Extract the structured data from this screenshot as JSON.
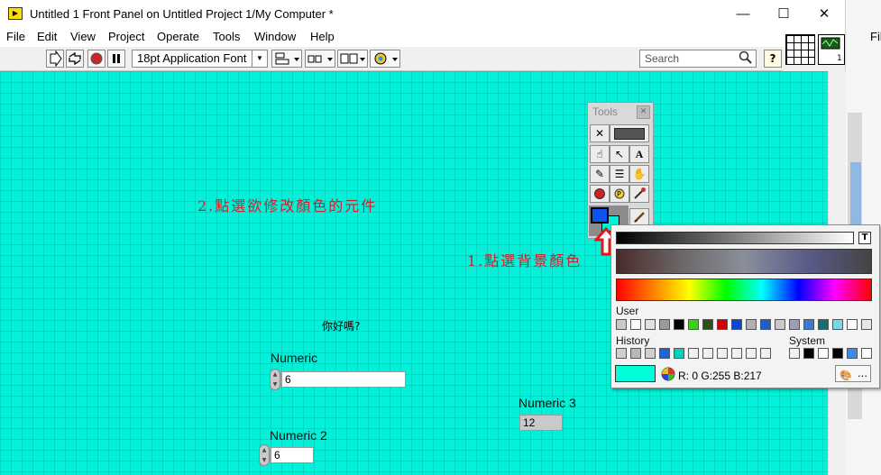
{
  "window": {
    "title": "Untitled 1 Front Panel on Untitled Project 1/My Computer *",
    "controls": {
      "minimize": "—",
      "maximize": "☐",
      "close": "✕"
    }
  },
  "menu": [
    "File",
    "Edit",
    "View",
    "Project",
    "Operate",
    "Tools",
    "Window",
    "Help"
  ],
  "toolbar": {
    "font": "18pt Application Font",
    "search_placeholder": "Search",
    "help": "?"
  },
  "panel": {
    "background": "#03f0d9",
    "annotation_1": "1.點選背景顏色",
    "annotation_2": "2.點選欲修改顏色的元件",
    "free_label": "你好嗎?",
    "controls": [
      {
        "label": "Numeric",
        "value": "6"
      },
      {
        "label": "Numeric 2",
        "value": "6"
      },
      {
        "label": "Numeric 3",
        "value": "12"
      }
    ]
  },
  "tools_palette": {
    "title": "Tools",
    "tools": [
      "auto-select",
      "led",
      "operate",
      "position",
      "text",
      "wire",
      "shortcut-menu",
      "scroll",
      "breakpoint",
      "probe",
      "get-color",
      "set-color",
      "paintbrush"
    ],
    "foreground_color": "#0a55f0",
    "background_color": "#03f0d9"
  },
  "color_picker": {
    "transparent_label": "T",
    "user_label": "User",
    "history_label": "History",
    "system_label": "System",
    "current_color": "#00ffd9",
    "rgb_text": "R:  0 G:255 B:217",
    "user_colors": [
      "#c8c8c8",
      "#ffffff",
      "#e0e0e0",
      "#9a9a9a",
      "#000000",
      "#3cd214",
      "#2f4f1a",
      "#d90000",
      "#0a46d2",
      "#b0b0b0",
      "#1f5fc7",
      "#c8c8c8",
      "#9ba0b8",
      "#3a78d2",
      "#1b6e6e",
      "#7ad8e6",
      "#ffffff",
      "#e8e8e8"
    ],
    "history_colors": [
      "#d0d0d0",
      "#b8b8b8",
      "#d0d0d0",
      "#1e64d2",
      "#00d2be",
      "#f0f0f0",
      "#f0f0f0",
      "#f0f0f0",
      "#f0f0f0",
      "#f0f0f0",
      "#f0f0f0"
    ],
    "system_colors": [
      "#f0f0f0",
      "#000000",
      "#ffffff",
      "#000000",
      "#3c8ce6",
      "#ffffff"
    ]
  }
}
